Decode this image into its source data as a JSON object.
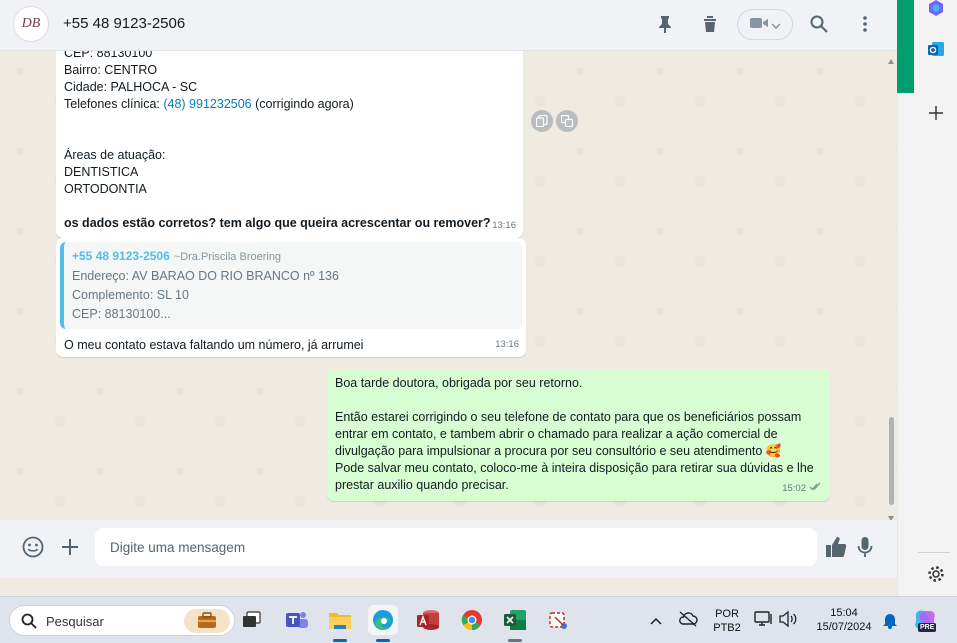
{
  "header": {
    "contact_name": "+55 48 9123-2506",
    "avatar_monogram": "DB"
  },
  "messages": {
    "m1": {
      "lines": [
        "CEP: 88130100",
        "Bairro: CENTRO",
        "Cidade: PALHOCA - SC"
      ],
      "phone_prefix": "Telefones clínica: ",
      "phone_link": "(48) 991232506",
      "phone_suffix": " (corrigindo agora)",
      "areas_title": "Áreas de atuação:",
      "area1": "DENTISTICA",
      "area2": "ORTODONTIA",
      "question": "os dados estão corretos? tem algo que queira acrescentar ou remover?",
      "time": "13:16"
    },
    "m2": {
      "quote_name": "+55 48 9123-2506",
      "quote_alt": "~Dra.Priscila Broering",
      "quote_line1": "Endereço: AV BARAO DO RIO BRANCO nº 136",
      "quote_line2": "Complemento: SL 10",
      "quote_line3": "CEP: 88130100...",
      "text": "O meu contato estava faltando um número, já arrumei",
      "time": "13:16"
    },
    "m3": {
      "line1": "Boa tarde doutora, obrigada por seu retorno.",
      "line2": "Então estarei corrigindo o seu telefone de contato para que os beneficiários possam",
      "line3": "entrar em contato, e tambem abrir o chamado para realizar a ação comercial de",
      "line4": "divulgação para impulsionar a procura por seu consultório e seu atendimento 🥰",
      "line5": "Pode salvar meu contato, coloco-me à inteira disposição para retirar sua dúvidas e lhe",
      "line6": "prestar auxilio quando precisar.",
      "time": "15:02"
    }
  },
  "composer": {
    "placeholder": "Digite uma mensagem"
  },
  "taskbar": {
    "search_placeholder": "Pesquisar",
    "lang_top": "POR",
    "lang_bottom": "PTB2",
    "clock_time": "15:04",
    "clock_date": "15/07/2024",
    "copilot_badge": "PRE"
  },
  "colors": {
    "accent_green": "#009d6e",
    "outgoing_bubble": "#d9fdd3",
    "link_blue": "#027eb5",
    "quote_bar": "#53bdeb"
  }
}
